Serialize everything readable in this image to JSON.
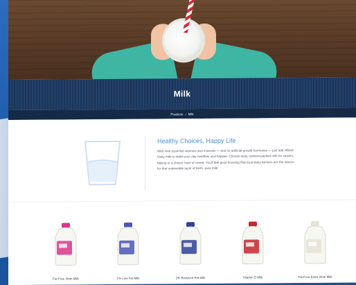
{
  "hero": {
    "title": "Milk"
  },
  "breadcrumb": {
    "items": [
      "Products",
      "Milk"
    ],
    "separator": "›"
  },
  "intro": {
    "heading": "Healthy Choices, Happy Life",
    "body": "With nine essential vitamins and minerals — and no artificial growth hormones — just add Hiland Dairy milk to make your day healthier and happier. Choose tasty, nutrient-packed milk for snacks, baking or a classic bowl of cereal. You'll feel good knowing that local dairy farmers are the reason for that undeniable taste of fresh, pure milk."
  },
  "products": [
    {
      "label": "Fat Free Skim Milk",
      "cap_color": "#d9368e"
    },
    {
      "label": "1% Low Fat Milk",
      "cap_color": "#4a57b8"
    },
    {
      "label": "2% Reduced Fat Milk",
      "cap_color": "#2f3f9a"
    },
    {
      "label": "Vitamin D Milk",
      "cap_color": "#c8262f"
    },
    {
      "label": "Fat Free Extra Skim Milk",
      "cap_color": "#e8e2d6"
    }
  ],
  "colors": {
    "accent": "#4a90d9",
    "title_band": "#1d3659",
    "breadcrumb_band": "#142a47"
  },
  "icons": {
    "intro_icon": "milk-glass-icon"
  }
}
